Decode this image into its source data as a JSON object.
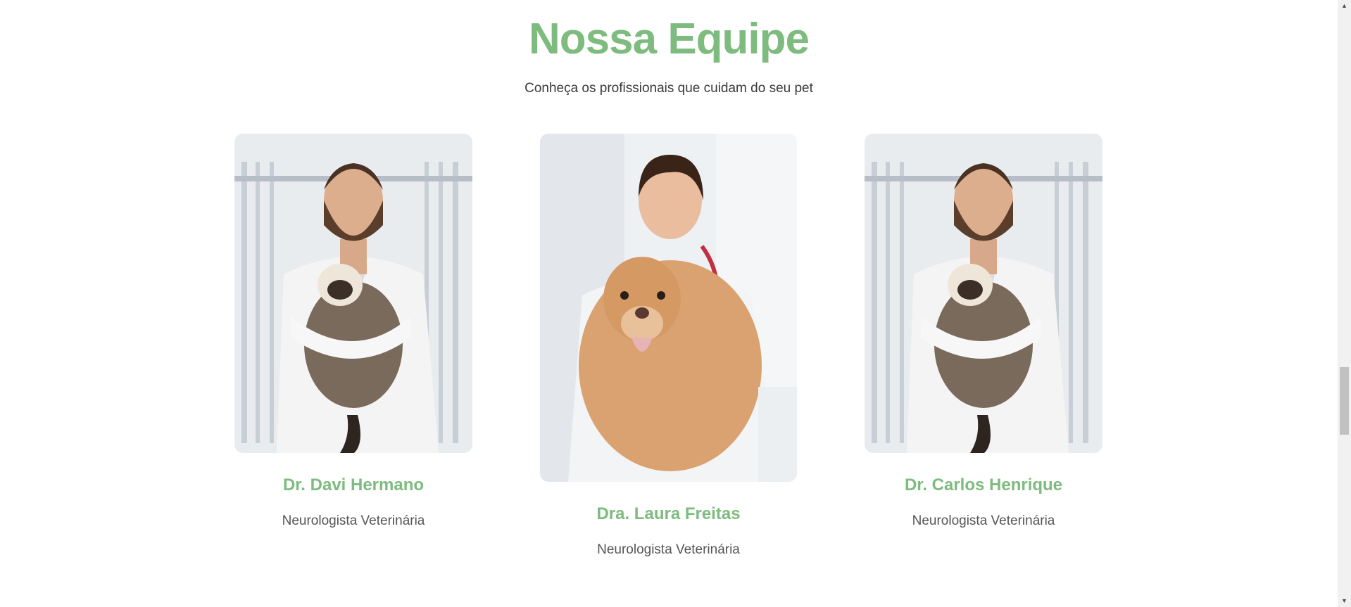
{
  "section": {
    "title": "Nossa Equipe",
    "subtitle": "Conheça os profissionais que cuidam do seu pet"
  },
  "team": [
    {
      "name": "Dr. Davi Hermano",
      "role": "Neurologista Veterinária",
      "photo_alt": "Veterinário segurando um gato"
    },
    {
      "name": "Dra. Laura Freitas",
      "role": "Neurologista Veterinária",
      "photo_alt": "Veterinária com um cachorro golden retriever"
    },
    {
      "name": "Dr. Carlos Henrique",
      "role": "Neurologista Veterinária",
      "photo_alt": "Veterinário segurando um gato"
    }
  ],
  "colors": {
    "accent": "#7dbb7e",
    "text": "#3a3a3a",
    "muted": "#555555"
  }
}
